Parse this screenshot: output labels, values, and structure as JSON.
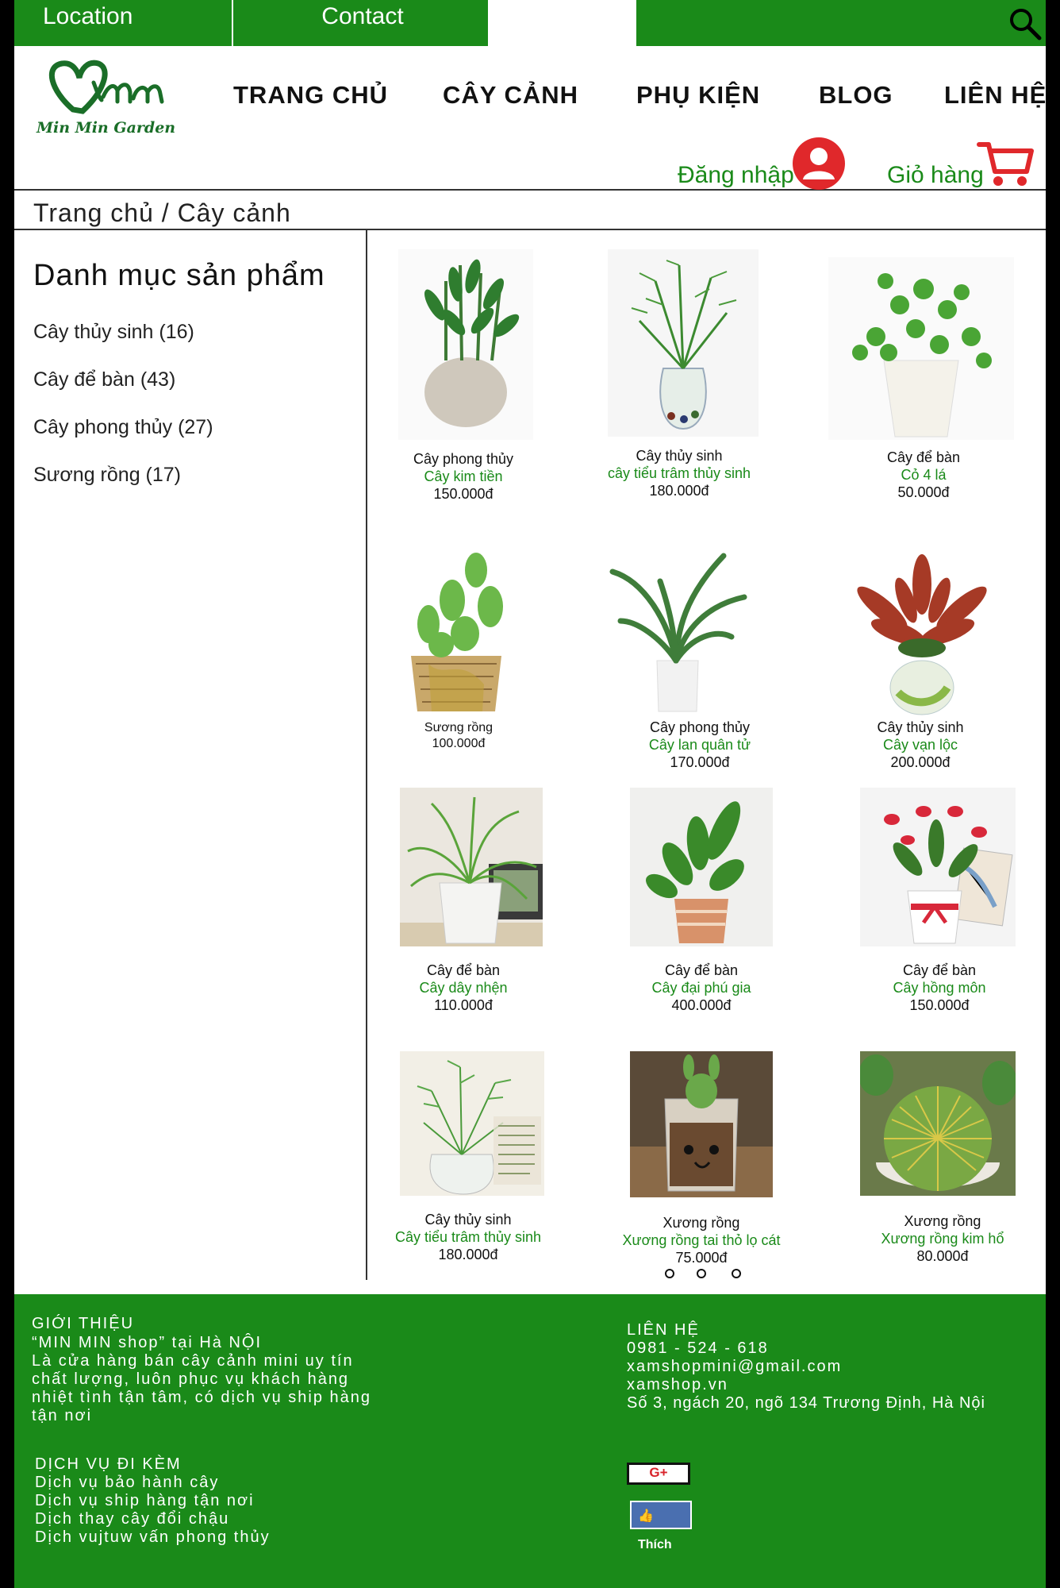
{
  "topbar": {
    "location_label": "Location",
    "contact_label": "Contact"
  },
  "brand": {
    "logo_text": "Min Min Garden"
  },
  "nav": {
    "home": "TRANG CHỦ",
    "plants": "CÂY CẢNH",
    "accessories": "PHỤ KIỆN",
    "blog": "BLOG",
    "contact": "LIÊN HỆ"
  },
  "account": {
    "login_label": "Đăng nhập",
    "cart_label": "Giỏ hàng"
  },
  "breadcrumb": "Trang chủ / Cây cảnh",
  "sidebar": {
    "title": "Danh mục sản phẩm",
    "categories": [
      "Cây thủy sinh (16)",
      "Cây để bàn (43)",
      "Cây phong thủy (27)",
      "Sương rồng (17)"
    ]
  },
  "products": [
    {
      "type": "Cây phong thủy",
      "name": "Cây kim tiền",
      "price": "150.000đ"
    },
    {
      "type": "Cây thủy sinh",
      "name": "cây tiểu trâm thủy sinh",
      "price": "180.000đ"
    },
    {
      "type": "Cây để bàn",
      "name": "Cỏ 4 lá",
      "price": "50.000đ"
    },
    {
      "type": "Sương rồng",
      "name": "",
      "price": "100.000đ"
    },
    {
      "type": "Cây phong thủy",
      "name": "Cây lan quân tử",
      "price": "170.000đ"
    },
    {
      "type": "Cây thủy sinh",
      "name": "Cây vạn lộc",
      "price": "200.000đ"
    },
    {
      "type": "Cây để bàn",
      "name": "Cây dây nhện",
      "price": "110.000đ"
    },
    {
      "type": "Cây để bàn",
      "name": "Cây đại phú gia",
      "price": "400.000đ"
    },
    {
      "type": "Cây để bàn",
      "name": "Cây hồng môn",
      "price": "150.000đ"
    },
    {
      "type": "Cây thủy sinh",
      "name": "Cây tiểu trâm thủy sinh",
      "price": "180.000đ"
    },
    {
      "type": "Xương rồng",
      "name": "Xương rồng tai thỏ lọ cát",
      "price": "75.000đ"
    },
    {
      "type": "Xương rồng",
      "name": "Xương rồng kim hổ",
      "price": "80.000đ"
    }
  ],
  "footer": {
    "intro_title": "GIỚI THIỆU",
    "intro_lines": [
      "“MIN MIN shop” tại Hà NỘI",
      "Là cửa hàng bán cây cảnh mini uy tín",
      "chất lượng, luôn phục vụ khách hàng",
      "nhiệt tình tận tâm, có dịch vụ ship hàng",
      "tận nơi"
    ],
    "services_title": "DỊCH VỤ ĐI KÈM",
    "services": [
      "Dịch vụ bảo hành cây",
      "Dịch vụ ship hàng tận nơi",
      "Dịch thay cây đổi chậu",
      "Dịch vujtuw vấn phong thủy"
    ],
    "contact_title": "LIÊN HỆ",
    "phone": "0981 - 524 - 618",
    "email": "xamshopmini@gmail.com",
    "website": "xamshop.vn",
    "address": "Số 3, ngách 20, ngõ 134 Trương Định, Hà Nội",
    "gplus_label": "G+",
    "like_label": "Thích"
  },
  "colors": {
    "brand_green": "#1a8a19",
    "accent_red": "#e0282b"
  }
}
